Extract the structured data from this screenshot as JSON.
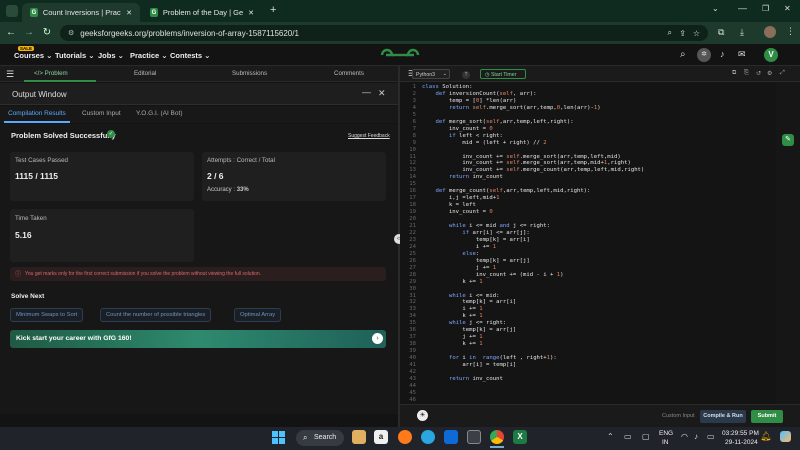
{
  "browser": {
    "tabs": [
      {
        "title": "Count Inversions | Practice | Ge",
        "active": true
      },
      {
        "title": "Problem of the Day | GeeksforG",
        "active": false
      }
    ],
    "url": "geeksforgeeks.org/problems/inversion-of-array-1587115620/1"
  },
  "site": {
    "badge": "SALE",
    "nav": [
      "Courses ⌄",
      "Tutorials ⌄",
      "Jobs ⌄",
      "Practice ⌄",
      "Contests ⌄"
    ],
    "avatar": "V",
    "brand_color": "#2f8d46"
  },
  "left_tabs": [
    "</> Problem",
    "Editorial",
    "Submissions",
    "Comments"
  ],
  "output_window": {
    "title": "Output Window",
    "tabs": [
      "Compilation Results",
      "Custom Input",
      "Y.O.G.I. (AI Bot)"
    ],
    "status": "Problem Solved Successfully",
    "feedback": "Suggest Feedback",
    "test_cases_label": "Test Cases Passed",
    "test_cases_value": "1115 / 1115",
    "attempts_label": "Attempts : Correct / Total",
    "attempts_value": "2 / 6",
    "accuracy_label": "Accuracy : ",
    "accuracy_value": "33%",
    "time_label": "Time Taken",
    "time_value": "5.16",
    "notice": "You get marks only for the first correct submission if you solve the problem without viewing the full solution.",
    "solve_next_label": "Solve Next",
    "solve_next": [
      "Minimum Swaps to Sort",
      "Count the number of possible triangles",
      "Optimal Array"
    ],
    "banner": "Kick start your career with GfG 160!"
  },
  "editor": {
    "language": "Python3",
    "timer": "Start Timer",
    "custom_input": "Custom Input",
    "compile_run": "Compile & Run",
    "submit": "Submit",
    "lines": [
      "class Solution:",
      "    def inversionCount(self, arr):",
      "        temp = [0] *len(arr)",
      "        return self.merge_sort(arr,temp,0,len(arr)-1)",
      "",
      "    def merge_sort(self,arr,temp,left,right):",
      "        inv_count = 0",
      "        if left < right:",
      "            mid = (left + right) // 2",
      "",
      "            inv_count += self.merge_sort(arr,temp,left,mid)",
      "            inv_count += self.merge_sort(arr,temp,mid+1,right)",
      "            inv_count += self.merge_count(arr,temp,left,mid,right)",
      "        return inv_count",
      "",
      "    def merge_count(self,arr,temp,left,mid,right):",
      "        i,j =left,mid+1",
      "        k = left",
      "        inv_count = 0",
      "",
      "        while i <= mid and j <= right:",
      "            if arr[i] <= arr[j]:",
      "                temp[k] = arr[i]",
      "                i += 1",
      "            else:",
      "                temp[k] = arr[j]",
      "                j += 1",
      "                inv_count += (mid - i + 1)",
      "            k += 1",
      "",
      "        while i <= mid:",
      "            temp[k] = arr[i]",
      "            i += 1",
      "            k += 1",
      "        while j <= right:",
      "            temp[k] = arr[j]",
      "            j += 1",
      "            k += 1",
      "",
      "        for i in  range(left , right+1):",
      "            arr[i] = temp[i]",
      "",
      "        return inv_count",
      "",
      "",
      ""
    ]
  },
  "taskbar": {
    "search": "Search",
    "lang1": "ENG",
    "lang2": "IN",
    "time": "03:29:55 PM",
    "date": "29-11-2024"
  }
}
